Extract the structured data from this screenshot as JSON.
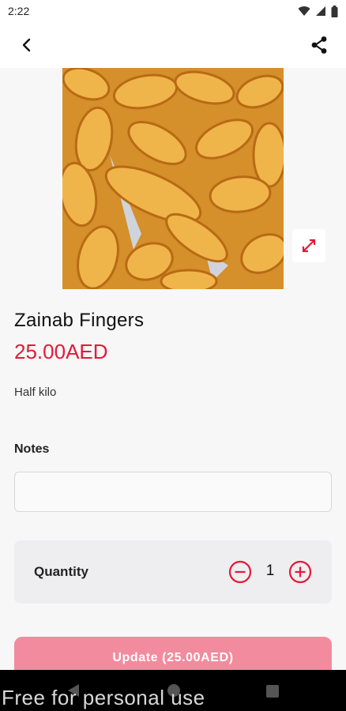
{
  "status_bar": {
    "time": "2:22",
    "icons": [
      "wifi-icon",
      "signal-icon",
      "battery-icon"
    ]
  },
  "app_bar": {
    "back_icon": "chevron-left-icon",
    "share_icon": "share-icon"
  },
  "product": {
    "image_icon": "product-photo",
    "expand_icon": "expand-icon",
    "name": "Zainab Fingers",
    "price": "25.00AED",
    "description": "Half kilo"
  },
  "notes": {
    "label": "Notes",
    "value": "",
    "placeholder": ""
  },
  "quantity": {
    "label": "Quantity",
    "value": "1",
    "minus_icon": "minus-circle-icon",
    "plus_icon": "plus-circle-icon"
  },
  "update_button": {
    "label": "Update (25.00AED)"
  },
  "watermark": "Free for personal use",
  "colors": {
    "accent": "#e41937",
    "button_disabled": "#f28b9d",
    "background": "#f7f7f8",
    "qty_card": "#eeeef1"
  }
}
